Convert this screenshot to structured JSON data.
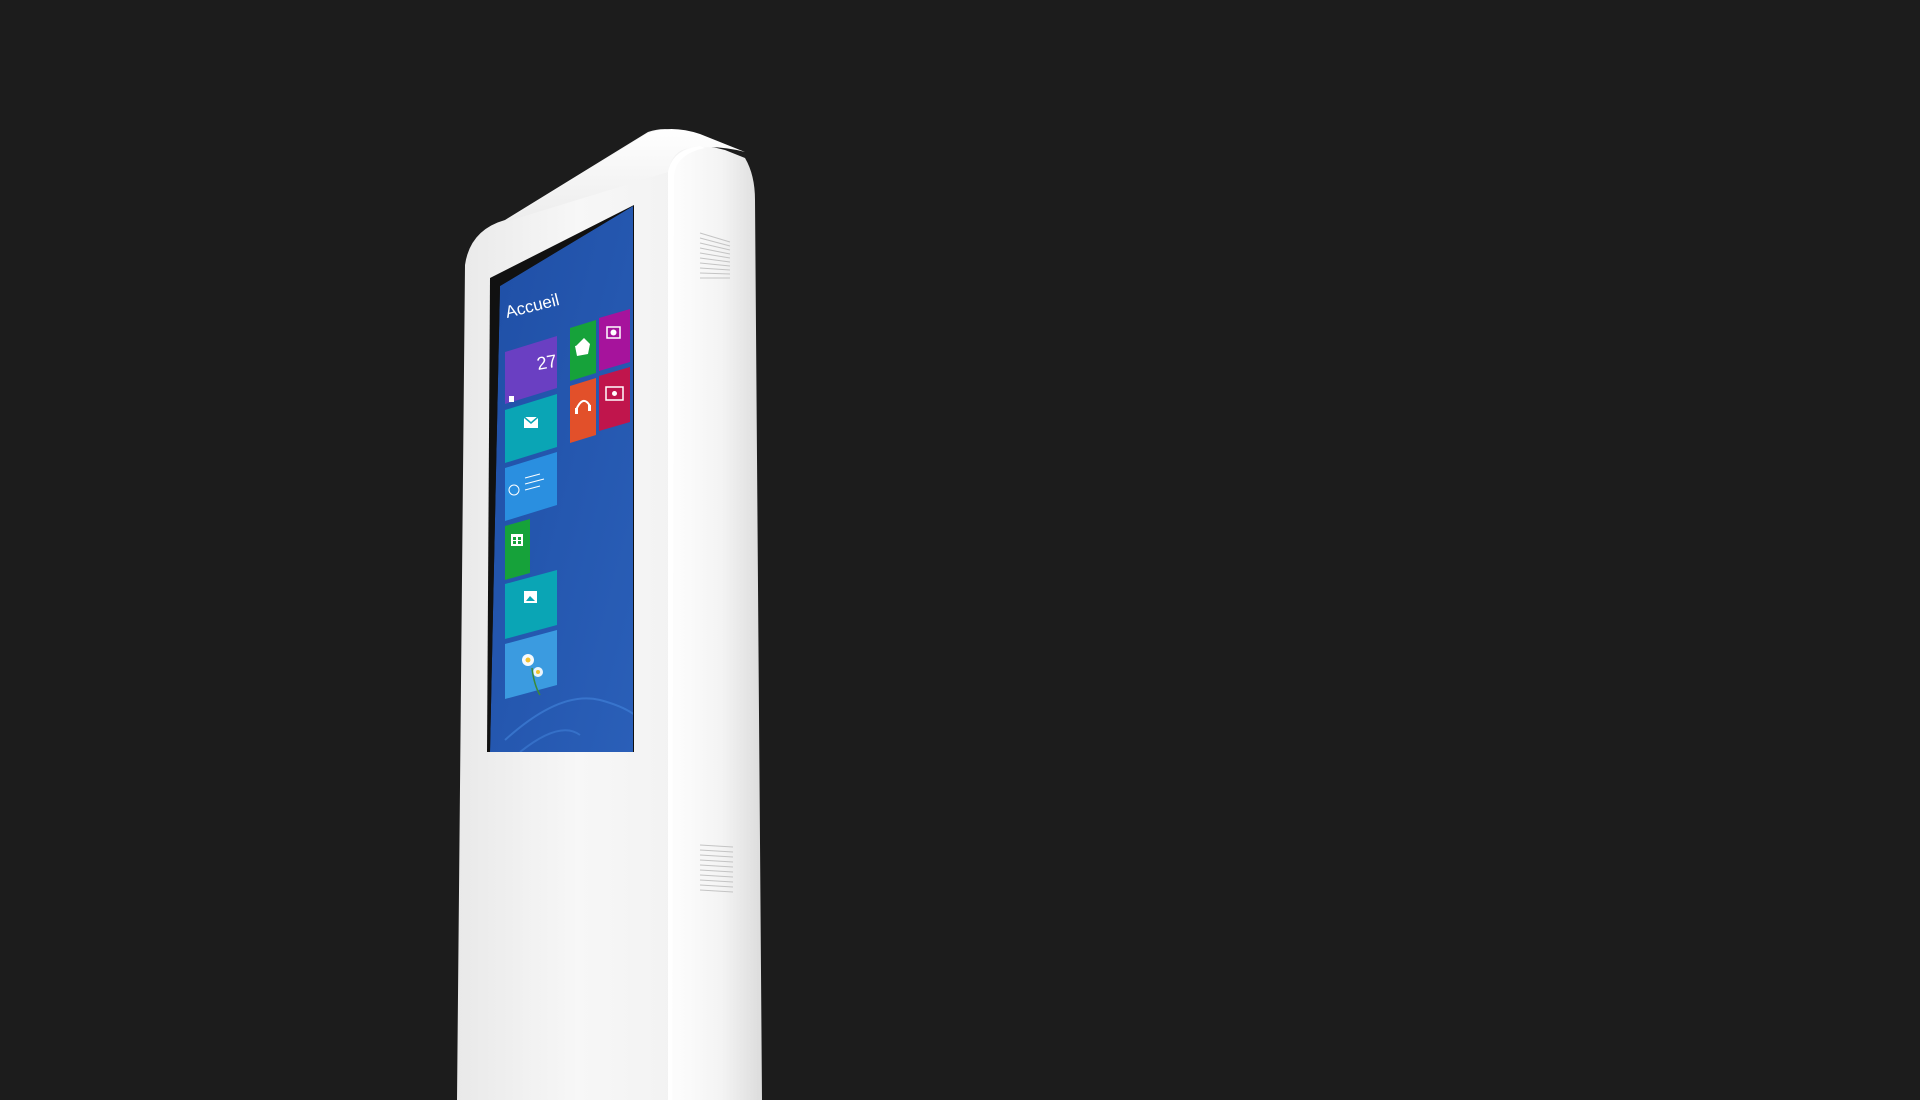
{
  "scene": {
    "background_color": "#1c1c1c",
    "kiosk_color": "#f3f3f3"
  },
  "screen": {
    "background_color": "#2554a8",
    "title": "Accueil",
    "tiles": [
      {
        "id": "calendar",
        "color": "#6a3fc2",
        "text": "27",
        "icon": "calendar-icon"
      },
      {
        "id": "mail",
        "color": "#0aa5b5",
        "icon": "mail-icon"
      },
      {
        "id": "weather",
        "color": "#2a8fe0",
        "icon": "weather-icon"
      },
      {
        "id": "store",
        "color": "#16a23a",
        "icon": "store-icon"
      },
      {
        "id": "photos",
        "color": "#0aa5b5",
        "icon": "photos-icon"
      },
      {
        "id": "desktop",
        "color": "#3b9be0",
        "icon": "flower-image"
      },
      {
        "id": "games",
        "color": "#16a23a",
        "icon": "gamepad-icon"
      },
      {
        "id": "camera",
        "color": "#a6139c",
        "icon": "camera-icon"
      },
      {
        "id": "music",
        "color": "#e2502a",
        "icon": "headphones-icon"
      },
      {
        "id": "video",
        "color": "#c0154c",
        "icon": "video-icon"
      }
    ]
  }
}
